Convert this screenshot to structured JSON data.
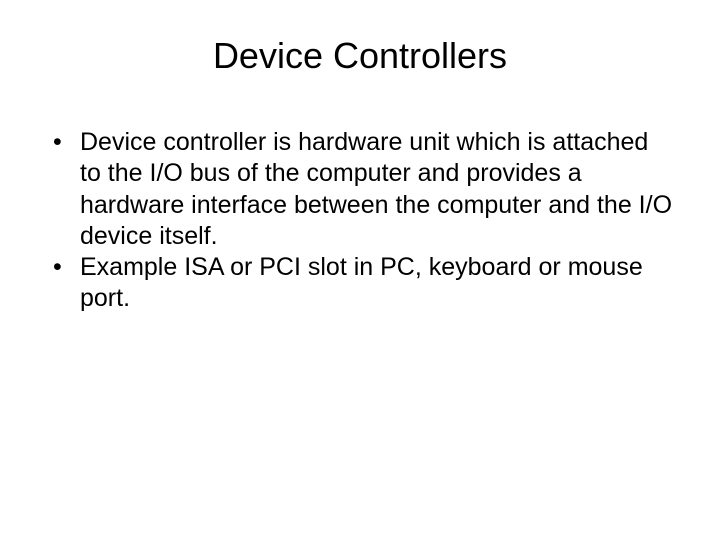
{
  "slide": {
    "title": "Device Controllers",
    "bullets": [
      "Device controller is hardware unit which is attached to the I/O bus of the computer and provides a hardware interface between the computer and the I/O device itself.",
      "Example ISA or PCI slot in PC, keyboard or mouse port."
    ]
  }
}
